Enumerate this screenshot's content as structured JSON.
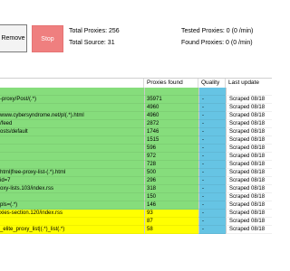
{
  "toolbar": {
    "remove_label": "Remove",
    "stop_label": "Stop",
    "total_proxies": "Total Proxies: 256",
    "total_source": "Total Source: 31",
    "tested_proxies": "Tested Proxies: 0 (0 /min)",
    "found_proxies": "Found Proxies: 0 (0 /min)"
  },
  "table": {
    "columns": [
      "",
      "Proxies found",
      "Quality",
      "Last update"
    ],
    "rows": [
      {
        "url": "",
        "found": "",
        "quality": "",
        "update": ""
      },
      {
        "url": "-proxy/Post/(.*)",
        "found": "35971",
        "quality": "-",
        "update": "Scraped 08/18"
      },
      {
        "url": "",
        "found": "4960",
        "quality": "-",
        "update": "Scraped 08/18"
      },
      {
        "url": "www.cybersyndrome.net/pl(.*).html",
        "found": "4960",
        "quality": "-",
        "update": "Scraped 08/18"
      },
      {
        "url": "/feed",
        "found": "2872",
        "quality": "-",
        "update": "Scraped 08/18"
      },
      {
        "url": "osts/default",
        "found": "1746",
        "quality": "-",
        "update": "Scraped 08/18"
      },
      {
        "url": "",
        "found": "1515",
        "quality": "-",
        "update": "Scraped 08/18"
      },
      {
        "url": "",
        "found": "596",
        "quality": "-",
        "update": "Scraped 08/18"
      },
      {
        "url": "",
        "found": "972",
        "quality": "-",
        "update": "Scraped 08/18"
      },
      {
        "url": "",
        "found": "728",
        "quality": "-",
        "update": "Scraped 08/18"
      },
      {
        "url": "html|free-proxy-list-(.*).html",
        "found": "500",
        "quality": "-",
        "update": "Scraped 08/18"
      },
      {
        "url": "id=7",
        "found": "296",
        "quality": "-",
        "update": "Scraped 08/18"
      },
      {
        "url": "oxy-lists.103/index.rss",
        "found": "318",
        "quality": "-",
        "update": "Scraped 08/18"
      },
      {
        "url": "",
        "found": "150",
        "quality": "-",
        "update": "Scraped 08/18"
      },
      {
        "url": "pls=(.*)",
        "found": "146",
        "quality": "-",
        "update": "Scraped 08/18"
      },
      {
        "url": "xies-section.120/index.rss",
        "found": "93",
        "quality": "-",
        "update": "Scraped 08/18"
      },
      {
        "url": "",
        "found": "87",
        "quality": "-",
        "update": "Scraped 08/18"
      },
      {
        "url": "_elite_proxy_list|(.*)_list(.*)",
        "found": "58",
        "quality": "-",
        "update": "Scraped 08/18"
      }
    ]
  },
  "colors": {
    "row_green": "#86dd7c",
    "row_yellow": "#ffff00",
    "quality_cyan": "#66c4e4",
    "stop_button": "#ef7f7f"
  }
}
